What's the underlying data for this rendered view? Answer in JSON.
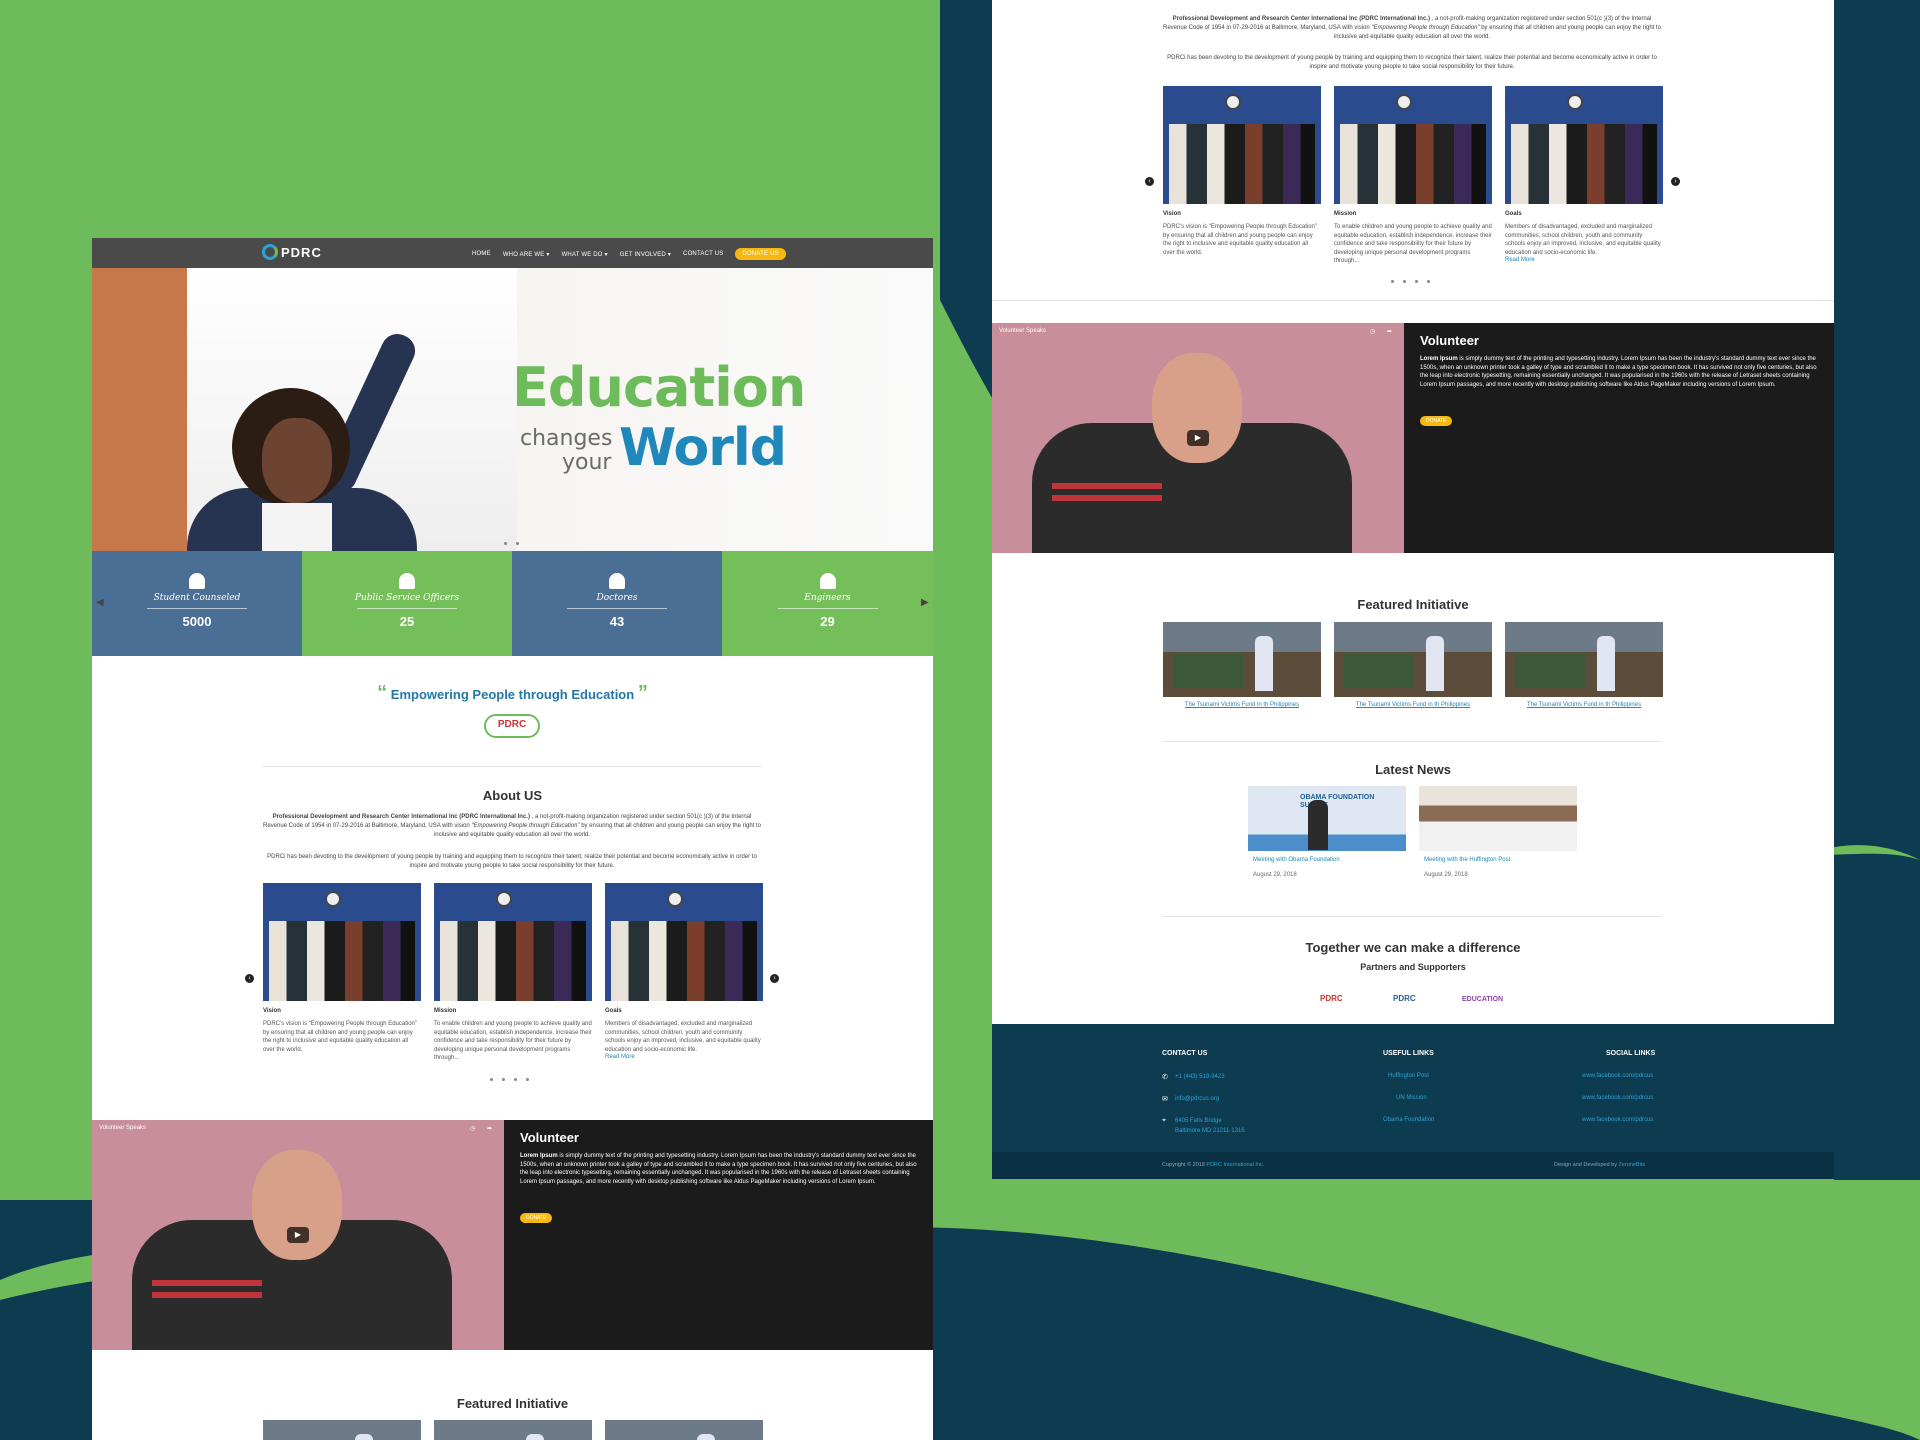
{
  "colors": {
    "green": "#6dbb5b",
    "blue": "#1f87b9",
    "navy": "#0d3b4f",
    "yellow": "#f6b912",
    "stat_blue": "#4b6f94",
    "stat_green": "#74bf5a"
  },
  "nav": {
    "logo_text": "PDRC",
    "items": [
      "HOME",
      "WHO ARE WE ▾",
      "WHAT WE DO ▾",
      "GET INVOLVED ▾",
      "CONTACT US"
    ],
    "donate": "DONATE US"
  },
  "hero": {
    "title": "Education",
    "changes": "changes",
    "your": "your",
    "world": "World"
  },
  "stats": [
    {
      "label": "Student Counseled",
      "value": "5000",
      "icon": "graduate-icon"
    },
    {
      "label": "Public Service Officers",
      "value": "25",
      "icon": "officer-icon"
    },
    {
      "label": "Doctores",
      "value": "43",
      "icon": "doctor-icon"
    },
    {
      "label": "Engineers",
      "value": "29",
      "icon": "engineer-icon"
    }
  ],
  "quote": {
    "open": "“",
    "text": "Empowering People through Education",
    "close": "”",
    "logo": "PDRC"
  },
  "about": {
    "title": "About US",
    "para1_bold": "Professional Development and Research Center International Inc (PDRC International Inc.)",
    "para1_a": ", a not-profit-making organization registered under section 501(c )(3) of the Internal Revenue Code of 1954 in 07-29-2016 at Baltimore, Maryland, USA with vision",
    "para1_italic": "“Empowering People through Education”",
    "para1_b": "by ensuring that all children and young people can enjoy the right to inclusive and equitable quality education all over the world.",
    "para2": "PDRCi has been devoting to the development of young people by training and equipping them to recognize their talent, realize their potential and become economically active in order to inspire and motivate young people to take social responsibility for their future.",
    "cards": [
      {
        "title": "Vision",
        "text": "PDRC's vision is “Empowering People through Education” by ensuring that all children and young people can enjoy the right to inclusive and equitable quality education all over the world.",
        "more": ""
      },
      {
        "title": "Mission",
        "text": "To enable children and young people to achieve quality and equitable education, establish independence, increase their confidence and take responsibility for their future by developing unique personal development programs through...",
        "more": ""
      },
      {
        "title": "Goals",
        "text": "Members of disadvantaged, excluded and marginalized communities, school children, youth and community schools enjoy an improved, inclusive, and equitable quality education and socio-economic life.",
        "more": "Read More"
      }
    ]
  },
  "volunteer": {
    "video_title": "Volunteer Speaks",
    "title": "Volunteer",
    "text_bold": "Lorem Ipsum",
    "text": "is simply dummy text of the printing and typesetting industry. Lorem Ipsum has been the industry's standard dummy text ever since the 1500s, when an unknown printer took a galley of type and scrambled it to make a type specimen book. It has survived not only five centuries, but also the leap into electronic typesetting, remaining essentially unchanged. It was popularised in the 1960s with the release of Letraset sheets containing Lorem Ipsum passages, and more recently with desktop publishing software like Aldus PageMaker including versions of Lorem Ipsum.",
    "donate": "DONATE"
  },
  "featured": {
    "title": "Featured Initiative",
    "items": [
      "The Tsunami Victims Fund in th Philippines",
      "The Tsunami Victims Fund in th Philippines",
      "The Tsunami Victims Fund in th Philippines"
    ]
  },
  "news": {
    "title": "Latest News",
    "items": [
      {
        "title": "Meeting with Obama Foundation",
        "date": "August 29, 2018",
        "banner": "OBAMA FOUNDATION SUMMIT"
      },
      {
        "title": "Meeting with the Huffington Post",
        "date": "August 29, 2018"
      }
    ]
  },
  "partners": {
    "title": "Together we can make a difference",
    "subtitle": "Partners and Supporters",
    "logos": [
      "PDRC",
      "PDRC",
      "EDUCATION"
    ]
  },
  "footer": {
    "contact_title": "CONTACT US",
    "phone": "+1 (443) 519-9423",
    "email": "info@pdrcus.org",
    "address1": "6405 Falls Bridge",
    "address2": "Baltimore MD 21211-1316",
    "useful_title": "USEFUL LINKS",
    "useful": [
      "Huffington Post",
      "UN Mission",
      "Obama Foundation"
    ],
    "social_title": "SOCIAL LINKS",
    "social": [
      "www.facebook.com/pdrcus",
      "www.facebook.com/pdrcus",
      "www.facebook.com/pdrcus"
    ],
    "copyright_prefix": "Copyright © 2018",
    "copyright_org": "PDRC International Inc.",
    "designed_prefix": "Design and Developed by",
    "designed_by": "ZeroneBits"
  }
}
